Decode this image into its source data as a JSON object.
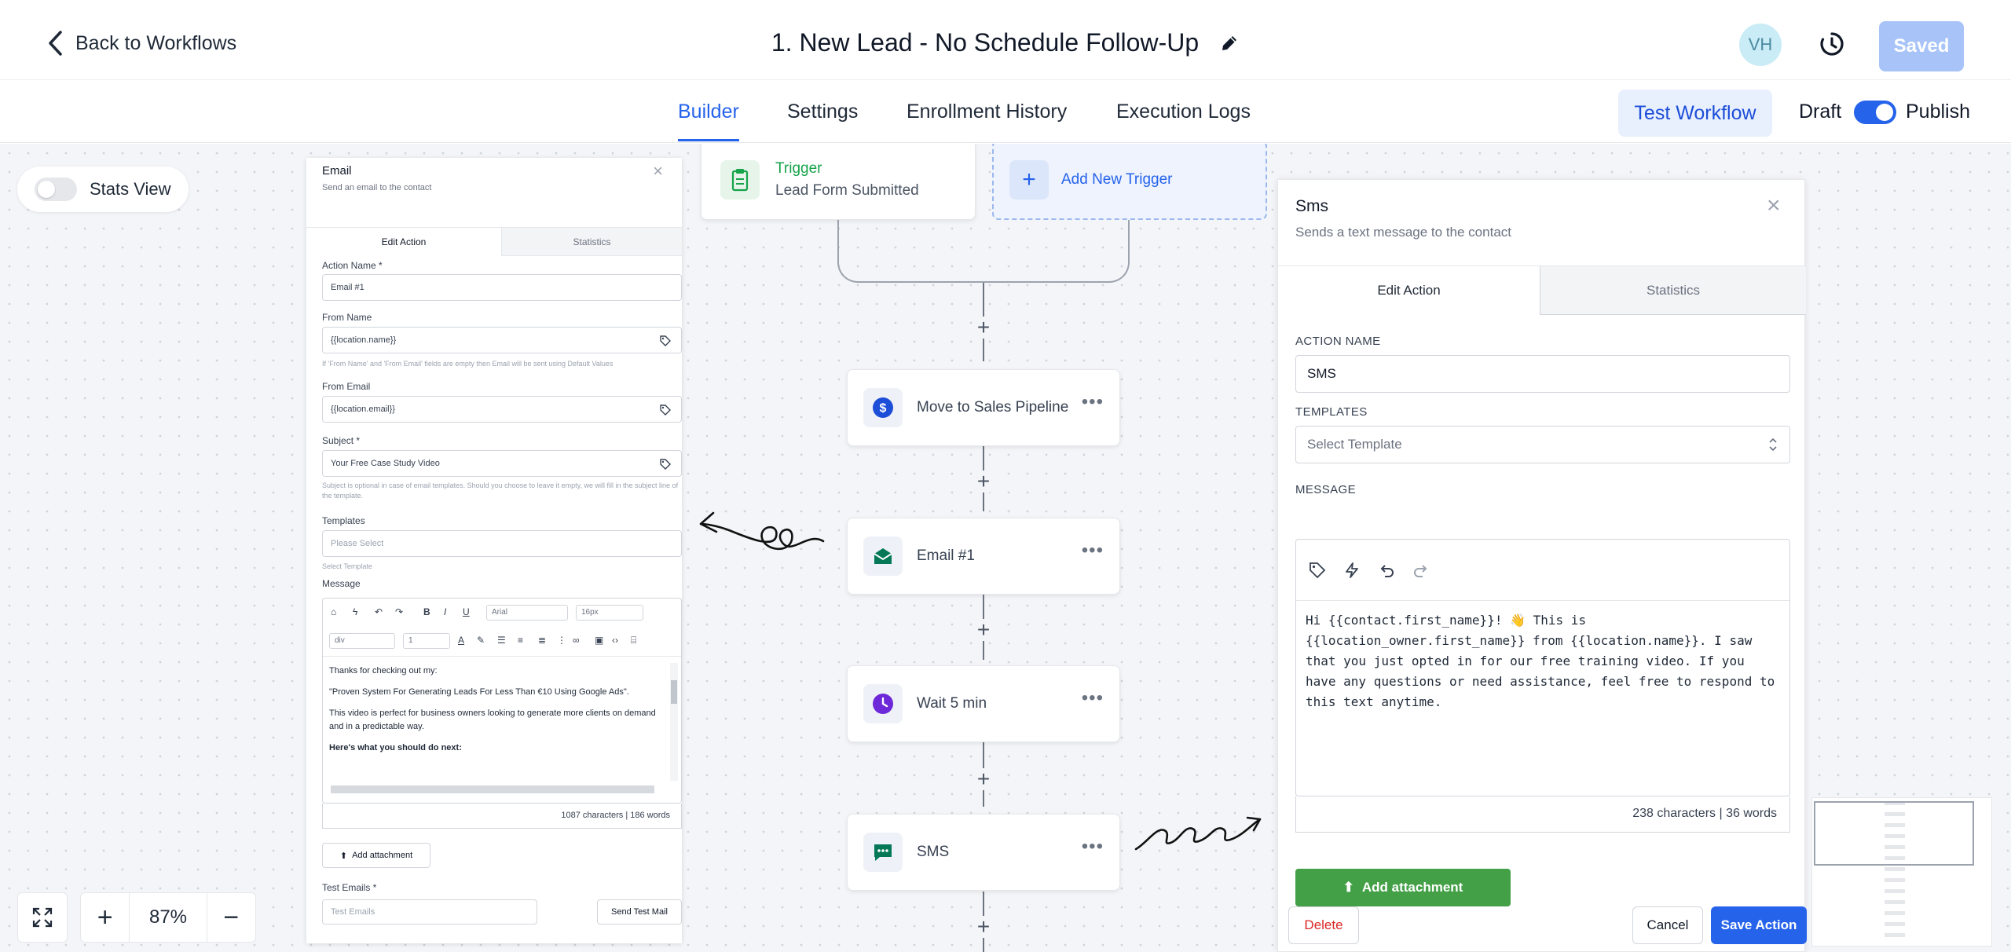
{
  "header": {
    "back_label": "Back to Workflows",
    "title": "1. New Lead - No Schedule Follow-Up",
    "avatar_initials": "VH",
    "saved_label": "Saved"
  },
  "tabs": {
    "builder": "Builder",
    "settings": "Settings",
    "enrollment_history": "Enrollment History",
    "execution_logs": "Execution Logs",
    "active": "Builder"
  },
  "actions": {
    "test_workflow": "Test Workflow",
    "draft": "Draft",
    "publish": "Publish",
    "publish_enabled": true
  },
  "canvas": {
    "stats_view_label": "Stats View",
    "zoom": "87%"
  },
  "trigger": {
    "label": "Trigger",
    "name": "Lead Form Submitted",
    "add_label": "Add New Trigger"
  },
  "nodes": [
    {
      "label": "Move to Sales Pipeline",
      "icon": "dollar-icon",
      "color": "#1d4ed8"
    },
    {
      "label": "Email #1",
      "icon": "envelope-icon",
      "color": "#047857"
    },
    {
      "label": "Wait 5 min",
      "icon": "clock-icon",
      "color": "#6d28d9"
    },
    {
      "label": "SMS",
      "icon": "message-icon",
      "color": "#047857"
    }
  ],
  "email_panel": {
    "title": "Email",
    "subtitle": "Send an email to the contact",
    "tab_edit": "Edit Action",
    "tab_stats": "Statistics",
    "action_name_label": "Action Name *",
    "action_name_value": "Email #1",
    "from_name_label": "From Name",
    "from_name_value": "{{location.name}}",
    "from_hint": "If 'From Name' and 'From Email' fields are empty then Email will be sent using Default Values",
    "from_email_label": "From Email",
    "from_email_value": "{{location.email}}",
    "subject_label": "Subject *",
    "subject_value": "Your Free Case Study Video",
    "subject_hint": "Subject is optional in case of email templates. Should you choose to leave it empty, we will fill in the subject line of the template.",
    "templates_label": "Templates",
    "templates_placeholder": "Please Select",
    "select_template_hint": "Select Template",
    "message_label": "Message",
    "font_family": "Arial",
    "font_size": "16px",
    "block_type": "div",
    "line_height": "1",
    "body": [
      "Thanks for checking out my:",
      "\"Proven System For Generating Leads For Less Than €10 Using Google Ads\".",
      "This video is perfect for business owners looking to generate more clients on demand and in a predictable way.",
      "Here's what you should do next:"
    ],
    "count": "1087 characters | 186 words",
    "attach_label": "Add attachment",
    "test_emails_label": "Test Emails *",
    "test_emails_placeholder": "Test Emails",
    "send_test_label": "Send Test Mail"
  },
  "sms_panel": {
    "title": "Sms",
    "subtitle": "Sends a text message to the contact",
    "tab_edit": "Edit Action",
    "tab_stats": "Statistics",
    "action_name_label": "ACTION NAME",
    "action_name_value": "SMS",
    "templates_label": "TEMPLATES",
    "templates_placeholder": "Select Template",
    "message_label": "MESSAGE",
    "message": "Hi {{contact.first_name}}! 👋 This is {{location_owner.first_name}} from {{location.name}}. I saw that you just opted in for our free training video. If you have any questions or need assistance, feel free to respond to this text anytime.",
    "count": "238 characters | 36 words",
    "attach_label": "Add attachment",
    "delete_label": "Delete",
    "cancel_label": "Cancel",
    "save_label": "Save Action"
  },
  "colors": {
    "accent": "#2563eb",
    "attach_green": "#43a047",
    "saved_disabled": "#a7c3f8",
    "danger": "#dc2626"
  }
}
